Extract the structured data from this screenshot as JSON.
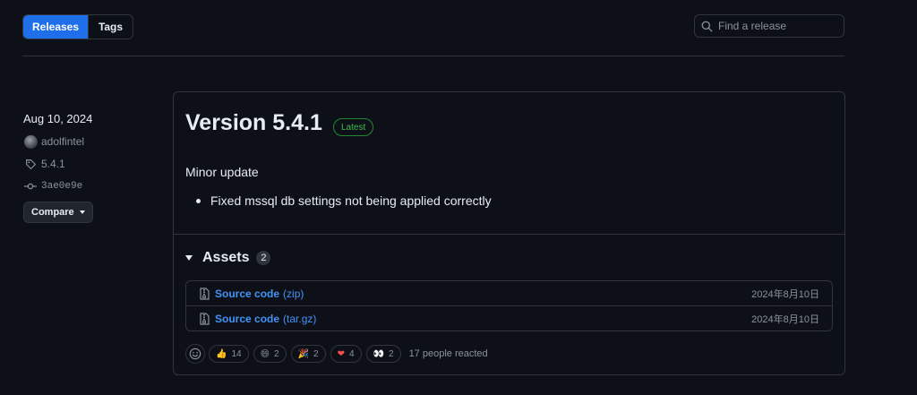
{
  "tabs": {
    "releases": "Releases",
    "tags": "Tags"
  },
  "search": {
    "placeholder": "Find a release"
  },
  "sidebar": {
    "date": "Aug 10, 2024",
    "author": "adolfintel",
    "tag": "5.4.1",
    "commit": "3ae0e9e",
    "compare_label": "Compare"
  },
  "release": {
    "title": "Version 5.4.1",
    "badge": "Latest",
    "summary": "Minor update",
    "bullets": [
      "Fixed mssql db settings not being applied correctly"
    ]
  },
  "assets": {
    "label": "Assets",
    "count": "2",
    "items": [
      {
        "name": "Source code",
        "ext": "(zip)",
        "date": "2024年8月10日"
      },
      {
        "name": "Source code",
        "ext": "(tar.gz)",
        "date": "2024年8月10日"
      }
    ]
  },
  "reactions": {
    "items": [
      {
        "icon": "thumbs-up-icon",
        "emoji": "👍",
        "count": "14"
      },
      {
        "icon": "laugh-icon",
        "emoji": "😄",
        "count": "2"
      },
      {
        "icon": "hooray-icon",
        "emoji": "🎉",
        "count": "2"
      },
      {
        "icon": "heart-icon",
        "emoji": "❤",
        "count": "4"
      },
      {
        "icon": "eyes-icon",
        "emoji": "👀",
        "count": "2"
      }
    ],
    "summary": "17 people reacted"
  },
  "colors": {
    "accent": "#1f6feb",
    "link": "#4493f8",
    "latest": "#3fb950",
    "background": "#0d1117",
    "border": "#30363d"
  }
}
